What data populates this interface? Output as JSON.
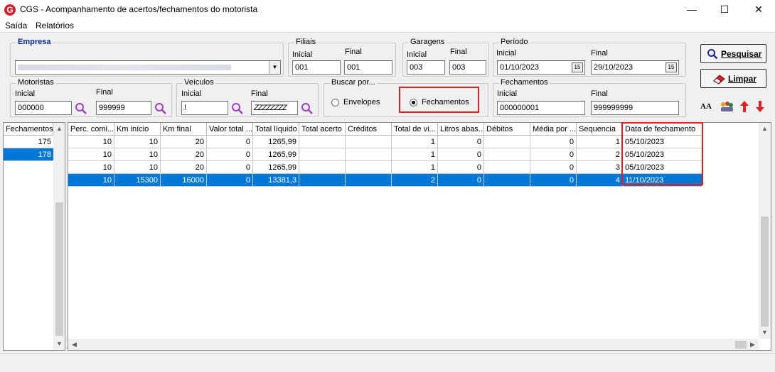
{
  "window": {
    "logo": "G",
    "title": "CGS - Acompanhamento de acertos/fechamentos do motorista",
    "minimize": "—",
    "maximize": "☐",
    "close": "✕"
  },
  "menu": {
    "items": [
      "Saída",
      "Relatórios"
    ]
  },
  "filters": {
    "empresa": {
      "legend": "Empresa",
      "value": ""
    },
    "filiais": {
      "legend": "Filiais",
      "initial_label": "Inicial",
      "final_label": "Final",
      "initial": "001",
      "final": "001"
    },
    "garagens": {
      "legend": "Garagens",
      "initial_label": "Inicial",
      "final_label": "Final",
      "initial": "003",
      "final": "003"
    },
    "periodo": {
      "legend": "Período",
      "initial_label": "Inicial",
      "final_label": "Final",
      "initial": "01/10/2023",
      "final": "29/10/2023",
      "cal_icon": "15"
    },
    "motoristas": {
      "legend": "Motoristas",
      "initial_label": "Inicial",
      "final_label": "Final",
      "initial": "000000",
      "final": "999999"
    },
    "veiculos": {
      "legend": "Veículos",
      "initial_label": "Inicial",
      "final_label": "Final",
      "initial": "!",
      "final": "ZZZZZZZZ"
    },
    "buscar": {
      "legend": "Buscar por...",
      "option1": "Envelopes",
      "option2": "Fechamentos",
      "selected": "Fechamentos"
    },
    "fechamentos": {
      "legend": "Fechamentos",
      "initial_label": "Inicial",
      "final_label": "Final",
      "initial": "000000001",
      "final": "999999999"
    }
  },
  "buttons": {
    "pesquisar": "Pesquisar",
    "limpar": "Limpar",
    "font_icon_text": "AA"
  },
  "left_grid": {
    "header": "Fechamentos",
    "rows": [
      "175",
      "178"
    ],
    "selected_index": 1
  },
  "main_grid": {
    "columns": [
      "Perc. comi...",
      "Km início",
      "Km final",
      "Valor total ...",
      "Total líquido",
      "Total acerto",
      "Créditos",
      "Total de vi...",
      "Litros abas...",
      "Débitos",
      "Média por ...",
      "Sequencia",
      "Data de fechamento"
    ],
    "rows": [
      [
        "10",
        "10",
        "20",
        "0",
        "1265,99",
        "",
        "",
        "1",
        "0",
        "",
        "0",
        "1",
        "05/10/2023"
      ],
      [
        "10",
        "10",
        "20",
        "0",
        "1265,99",
        "",
        "",
        "1",
        "0",
        "",
        "0",
        "2",
        "05/10/2023"
      ],
      [
        "10",
        "10",
        "20",
        "0",
        "1265,99",
        "",
        "",
        "1",
        "0",
        "",
        "0",
        "3",
        "05/10/2023"
      ],
      [
        "10",
        "15300",
        "16000",
        "0",
        "13381,3",
        "",
        "",
        "2",
        "0",
        "",
        "0",
        "4",
        "11/10/2023"
      ]
    ],
    "selected_index": 3
  }
}
